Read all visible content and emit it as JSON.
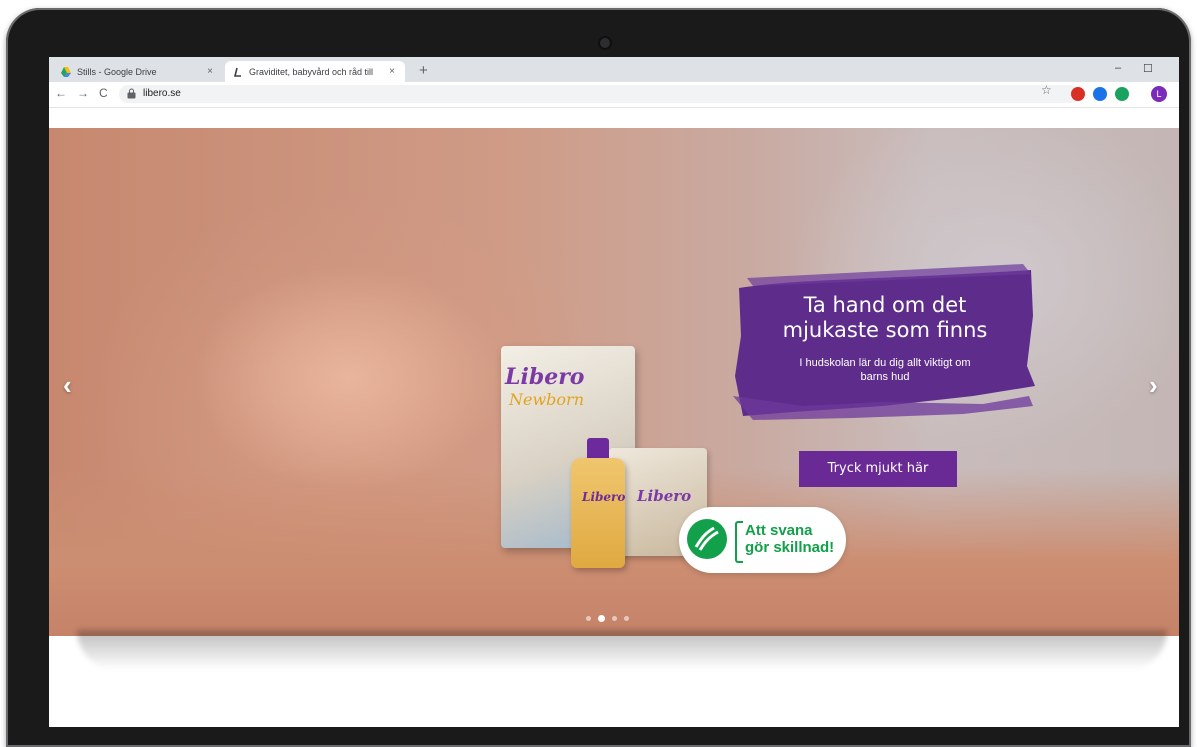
{
  "browser": {
    "tabs": [
      {
        "title": "Stills - Google Drive",
        "close": "×"
      },
      {
        "title": "Graviditet, babyvård och råd till",
        "close": "×"
      }
    ],
    "new_tab": "+",
    "window_controls": {
      "minimize": "–",
      "restore": "☐"
    },
    "nav": {
      "back": "←",
      "forward": "→",
      "reload": "C"
    },
    "url": "libero.se",
    "star": "☆",
    "profile_initial": "L",
    "extensions": [
      "red-extension-icon",
      "blue-extension-icon",
      "green-extension-icon"
    ]
  },
  "hero": {
    "title_line1": "Ta hand om det",
    "title_line2": "mjukaste som finns",
    "subtitle_line1": "I hudskolan lär du dig allt viktigt om",
    "subtitle_line2": "barns hud",
    "cta": "Tryck mjukt här",
    "prev": "‹",
    "next": "›",
    "active_slide": 2,
    "slide_count": 4,
    "products": {
      "box_brand": "Libero",
      "box_variant": "Newborn",
      "pack_brand": "Libero",
      "oil_brand": "Libero"
    },
    "badge": {
      "line1": "Att svana",
      "line2": "gör skillnad!"
    }
  },
  "colors": {
    "brand_purple": "#6a2a96",
    "swan_green": "#12a04a"
  }
}
